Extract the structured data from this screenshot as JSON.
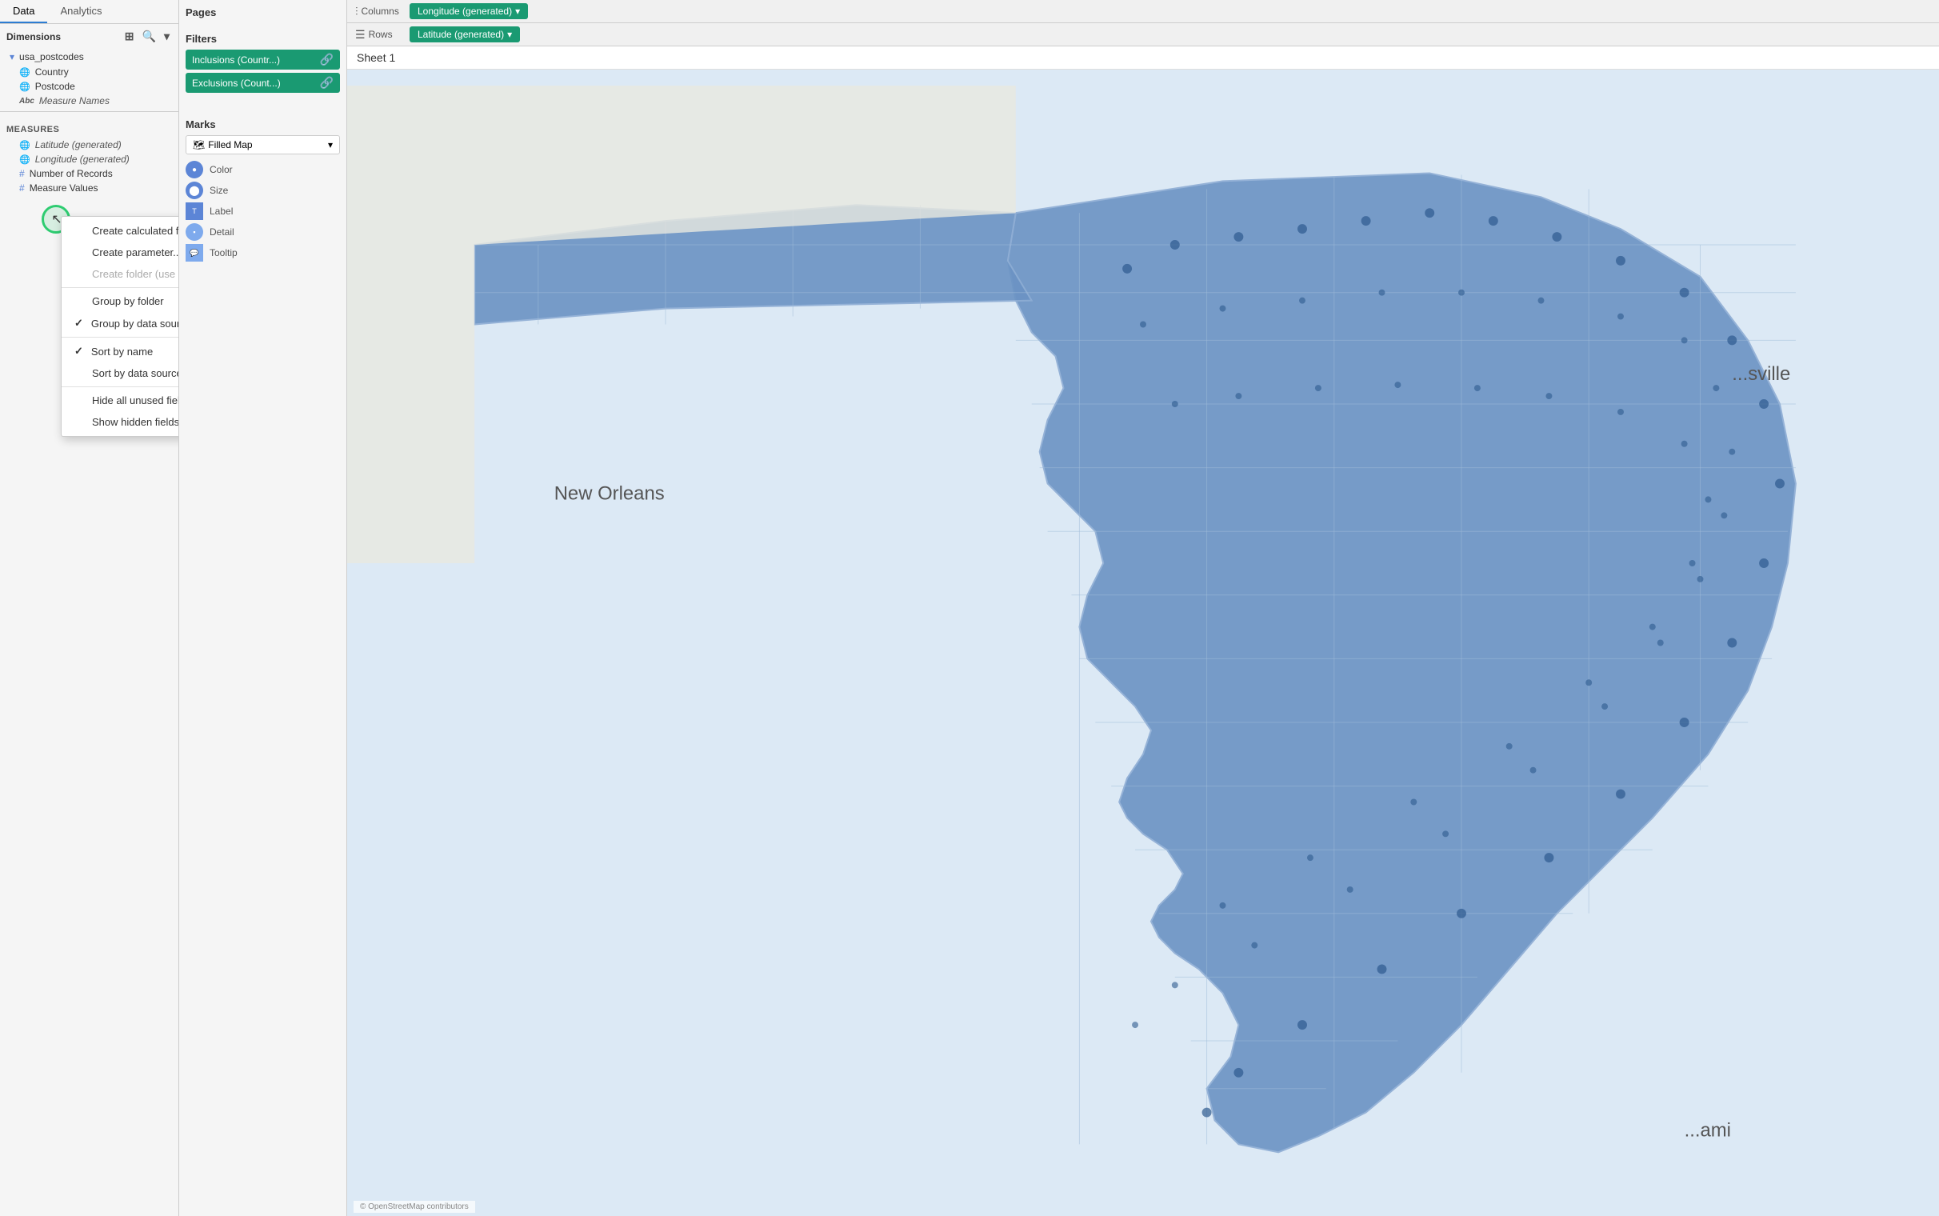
{
  "tabs": {
    "data_label": "Data",
    "analytics_label": "Analytics"
  },
  "left_panel": {
    "dimensions_label": "Dimensions",
    "datasource": {
      "name": "usa_postcodes"
    },
    "dimensions_items": [
      {
        "icon": "globe",
        "label": "Country",
        "italic": false
      },
      {
        "icon": "globe",
        "label": "Postcode",
        "italic": false
      }
    ],
    "measure_names_label": "Measure Names",
    "measures_label": "Measures",
    "measures_items": [
      {
        "icon": "globe",
        "label": "Latitude (generated)",
        "italic": true
      },
      {
        "icon": "globe",
        "label": "Longitude (generated)",
        "italic": true
      },
      {
        "icon": "hash",
        "label": "Number of Records"
      },
      {
        "icon": "hash",
        "label": "Measure Values"
      }
    ]
  },
  "context_menu": {
    "items": [
      {
        "id": "create-calculated",
        "label": "Create calculated field...",
        "type": "normal",
        "checked": false
      },
      {
        "id": "create-parameter",
        "label": "Create parameter...",
        "type": "normal",
        "checked": false
      },
      {
        "id": "create-folder",
        "label": "Create folder (use group by folder)",
        "type": "disabled",
        "checked": false
      },
      {
        "id": "sep1",
        "type": "separator"
      },
      {
        "id": "group-by-folder",
        "label": "Group by folder",
        "type": "normal",
        "checked": false
      },
      {
        "id": "group-by-datasource",
        "label": "Group by data source table",
        "type": "normal",
        "checked": true
      },
      {
        "id": "sep2",
        "type": "separator"
      },
      {
        "id": "sort-by-name",
        "label": "Sort by name",
        "type": "normal",
        "checked": true
      },
      {
        "id": "sort-by-datasource",
        "label": "Sort by data source order",
        "type": "normal",
        "checked": false
      },
      {
        "id": "sep3",
        "type": "separator"
      },
      {
        "id": "hide-unused",
        "label": "Hide all unused fields",
        "type": "normal",
        "checked": false
      },
      {
        "id": "show-hidden",
        "label": "Show hidden fields",
        "type": "normal",
        "checked": false
      }
    ]
  },
  "filters": {
    "label": "Filters",
    "items": [
      {
        "label": "Inclusions (Countr...)",
        "icon": "link"
      },
      {
        "label": "Exclusions (Count...)",
        "icon": "link"
      }
    ]
  },
  "marks": {
    "label": "Marks",
    "type": "Filled Map",
    "rows": [
      {
        "icon": "circle",
        "label": "Color"
      },
      {
        "icon": "size",
        "label": "Size"
      },
      {
        "label": "Label"
      },
      {
        "label": "Detail"
      },
      {
        "label": "Tooltip"
      }
    ]
  },
  "shelves": {
    "columns_label": "Columns",
    "columns_pill": "Longitude (generated)",
    "rows_label": "Rows",
    "rows_pill": "Latitude (generated)"
  },
  "map": {
    "sheet_title": "Sheet 1",
    "footer": "© OpenStreetMap contributors"
  }
}
